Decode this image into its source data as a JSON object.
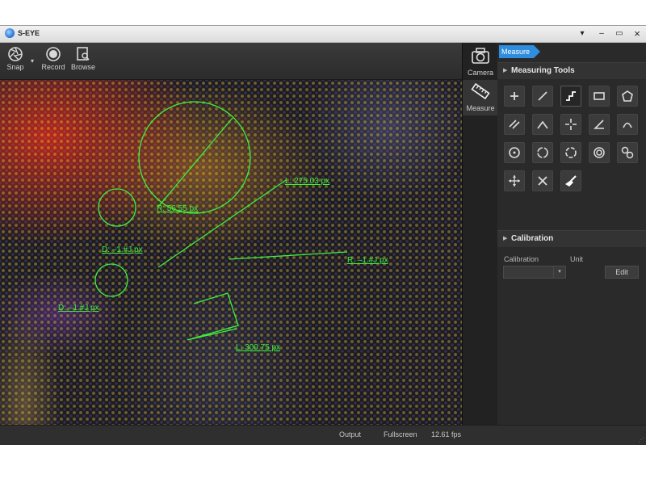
{
  "window": {
    "title": "S-EYE"
  },
  "titlebar_buttons": {
    "menu": "▾",
    "minimize": "–",
    "maximize": "▭",
    "close": "×"
  },
  "toolbar": {
    "snap_label": "Snap",
    "record_label": "Record",
    "browse_label": "Browse"
  },
  "modes": {
    "camera_label": "Camera",
    "measure_label": "Measure"
  },
  "panel": {
    "tab_label": "Measure",
    "measuring_tools_title": "Measuring Tools",
    "calibration_title": "Calibration",
    "calibration_label": "Calibration",
    "unit_label": "Unit",
    "calibration_value": "",
    "edit_label": "Edit",
    "tools": [
      "point-tool",
      "line-tool",
      "polyline-tool",
      "rectangle-tool",
      "polygon-tool",
      "parallel-lines-tool",
      "angle-vertex-tool",
      "crosshair-tool",
      "angle-tool",
      "arc-tool",
      "circle-center-tool",
      "circle-three-point-tool",
      "circle-fit-tool",
      "concentric-circles-tool",
      "two-circles-tool",
      "move-tool",
      "delete-tool",
      "clear-all-tool"
    ]
  },
  "measurements": {
    "radius_big": "R: 56.55 px",
    "diameter_upper": "D: –1.#J px",
    "length_line": "L: 275.03 px",
    "radius_line": "R: –1.#J px",
    "diameter_lower": "D: –1.#J px",
    "length_polyline": "L: 300.75 px"
  },
  "overlay_color": "#3cf03c",
  "status": {
    "output_label": "Output",
    "fullscreen_label": "Fullscreen",
    "fps": "12.61 fps"
  }
}
